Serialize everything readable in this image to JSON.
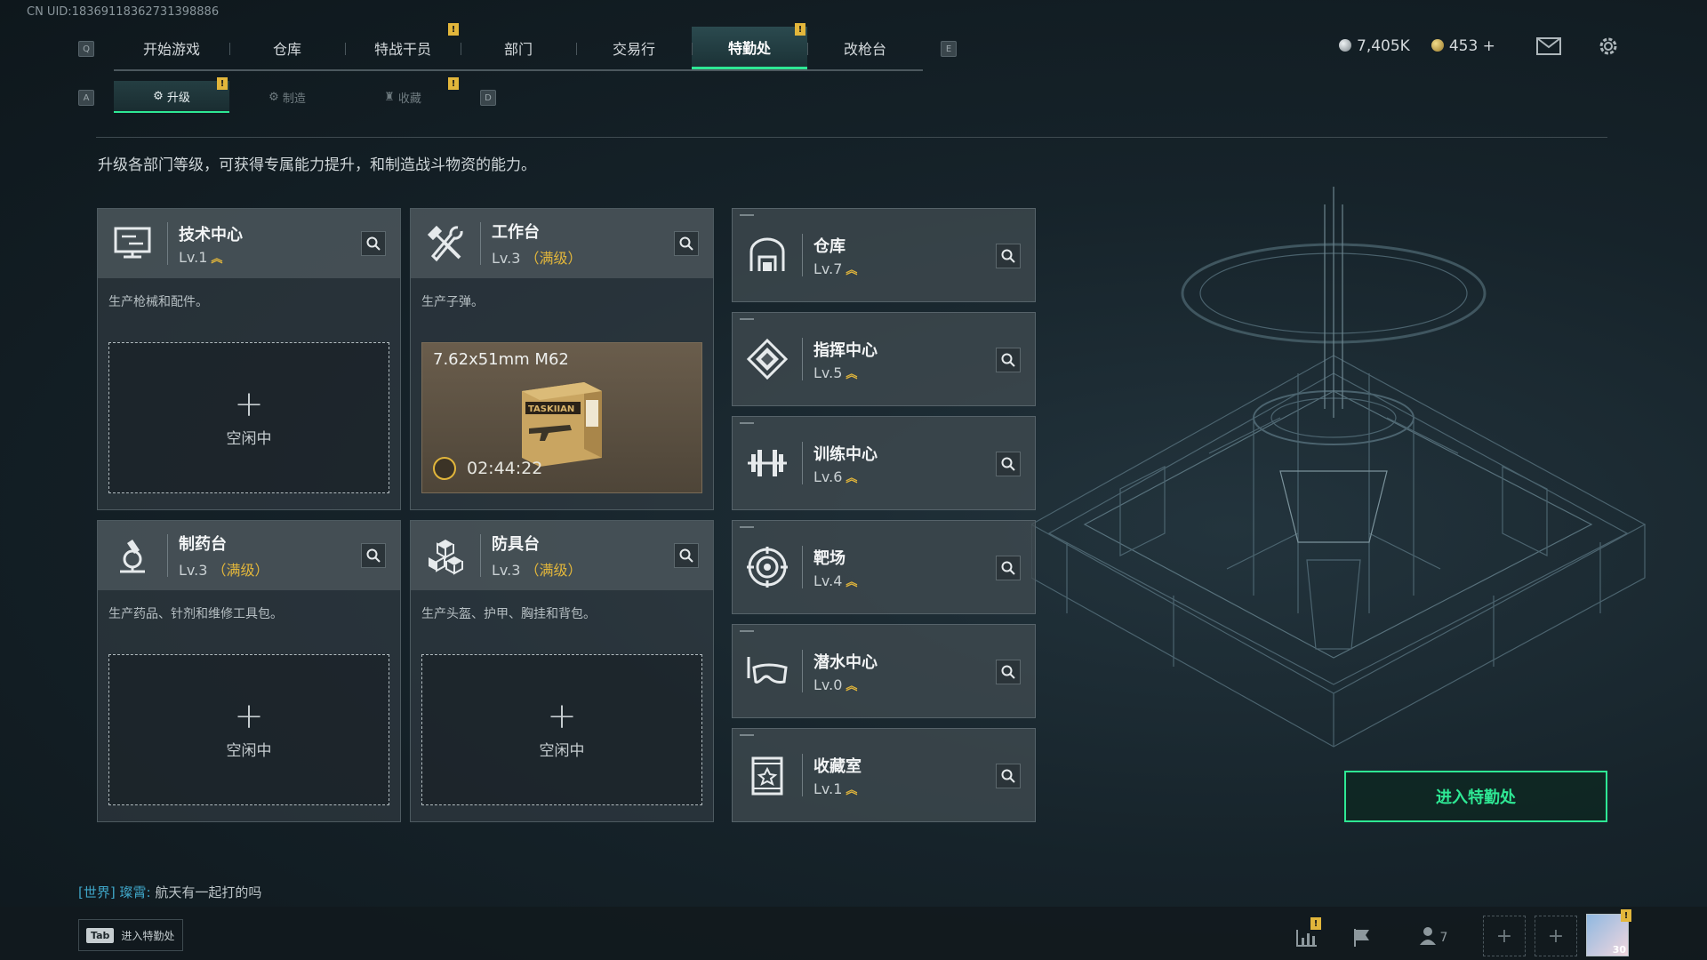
{
  "uid": "CN UID:18369118362731398886",
  "nav": {
    "left_key": "Q",
    "right_key": "E",
    "tabs": [
      {
        "label": "开始游戏",
        "active": false
      },
      {
        "label": "仓库",
        "active": false
      },
      {
        "label": "特战干员",
        "active": false,
        "alert": "!"
      },
      {
        "label": "部门",
        "active": false
      },
      {
        "label": "交易行",
        "active": false
      },
      {
        "label": "特勤处",
        "active": true,
        "alert": "!"
      },
      {
        "label": "改枪台",
        "active": false
      }
    ]
  },
  "currency": {
    "silver": "7,405K",
    "gold": "453 +"
  },
  "subnav": {
    "left_key": "A",
    "right_key": "D",
    "tabs": [
      {
        "label": "升级",
        "active": true,
        "alert": "!"
      },
      {
        "label": "制造",
        "active": false
      },
      {
        "label": "收藏",
        "active": false,
        "alert": "!"
      }
    ]
  },
  "description": "升级各部门等级，可获得专属能力提升，和制造战斗物资的能力。",
  "production_cards": [
    {
      "title": "技术中心",
      "level": "Lv.1",
      "maxed": "",
      "desc": "生产枪械和配件。",
      "slot": "空闲中",
      "icon": "monitor-icon"
    },
    {
      "title": "工作台",
      "level": "Lv.3",
      "maxed": "（满级）",
      "desc": "生产子弹。",
      "icon": "hammer-wrench-icon",
      "producing": {
        "item": "7.62x51mm M62",
        "timer": "02:44:22",
        "box_brand": "TASKIIAN"
      }
    },
    {
      "title": "制药台",
      "level": "Lv.3",
      "maxed": "（满级）",
      "desc": "生产药品、针剂和维修工具包。",
      "slot": "空闲中",
      "icon": "microscope-icon"
    },
    {
      "title": "防具台",
      "level": "Lv.3",
      "maxed": "（满级）",
      "desc": "生产头盔、护甲、胸挂和背包。",
      "slot": "空闲中",
      "icon": "cubes-icon"
    }
  ],
  "facility_cards": [
    {
      "title": "仓库",
      "level": "Lv.7",
      "icon": "warehouse-icon"
    },
    {
      "title": "指挥中心",
      "level": "Lv.5",
      "icon": "command-emblem-icon"
    },
    {
      "title": "训练中心",
      "level": "Lv.6",
      "icon": "dumbbell-icon"
    },
    {
      "title": "靶场",
      "level": "Lv.4",
      "icon": "target-icon"
    },
    {
      "title": "潜水中心",
      "level": "Lv.0",
      "icon": "diving-mask-icon"
    },
    {
      "title": "收藏室",
      "level": "Lv.1",
      "icon": "trophy-case-icon"
    }
  ],
  "enter_button": "进入特勤处",
  "chat": {
    "channel": "[世界]",
    "name": "璨霄:",
    "message": "航天有一起打的吗"
  },
  "bottom": {
    "tab_key": "Tab",
    "tab_label": "进入特勤处",
    "friends_count": "7",
    "alert": "!",
    "avatar_level": "30"
  }
}
